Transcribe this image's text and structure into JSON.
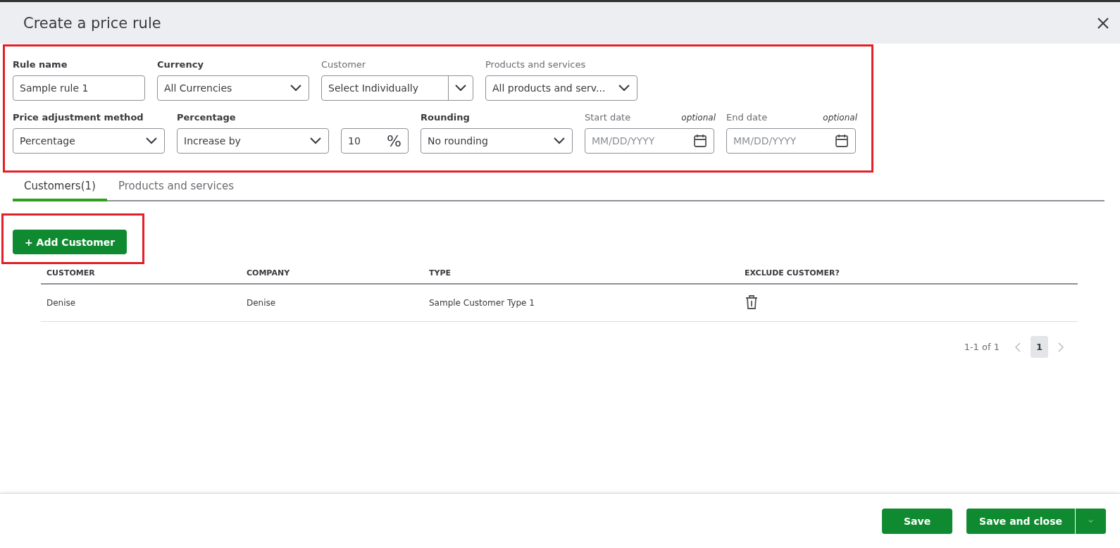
{
  "dialog": {
    "title": "Create a price rule"
  },
  "form_rows": [
    [
      {
        "kind": "text",
        "label": "Rule name",
        "emphasized": true,
        "value": "Sample rule 1"
      },
      {
        "kind": "select",
        "label": "Currency",
        "emphasized": true,
        "value": "All Currencies"
      },
      {
        "kind": "split-select",
        "label": "Customer",
        "emphasized": false,
        "value": "Select Individually"
      },
      {
        "kind": "select",
        "label": "Products and services",
        "emphasized": false,
        "value": "All products and serv..."
      }
    ],
    [
      {
        "kind": "select",
        "label": "Price adjustment method",
        "emphasized": true,
        "value": "Percentage"
      },
      {
        "kind": "select",
        "label": "Percentage",
        "emphasized": true,
        "value": "Increase by"
      },
      {
        "kind": "number",
        "value": "10",
        "suffix": "%"
      },
      {
        "kind": "select",
        "label": "Rounding",
        "emphasized": true,
        "value": "No rounding"
      },
      {
        "kind": "date",
        "label": "Start date",
        "emphasized": false,
        "note": "optional",
        "placeholder": "MM/DD/YYYY"
      },
      {
        "kind": "date",
        "label": "End date",
        "emphasized": false,
        "note": "optional",
        "placeholder": "MM/DD/YYYY"
      }
    ]
  ],
  "tabs": [
    {
      "label": "Customers(1)",
      "selected": true
    },
    {
      "label": "Products and services",
      "selected": false
    }
  ],
  "add_button": "+ Add Customer",
  "table": {
    "columns": [
      "CUSTOMER",
      "COMPANY",
      "TYPE",
      "EXCLUDE CUSTOMER?"
    ],
    "rows": [
      {
        "cells": [
          "Denise",
          "Denise",
          "Sample Customer Type 1"
        ]
      }
    ]
  },
  "pagination": {
    "range": "1-1 of 1",
    "pages": [
      {
        "label": "1",
        "selected": true
      }
    ]
  },
  "footer": {
    "save": "Save",
    "save_close": "Save and close"
  }
}
